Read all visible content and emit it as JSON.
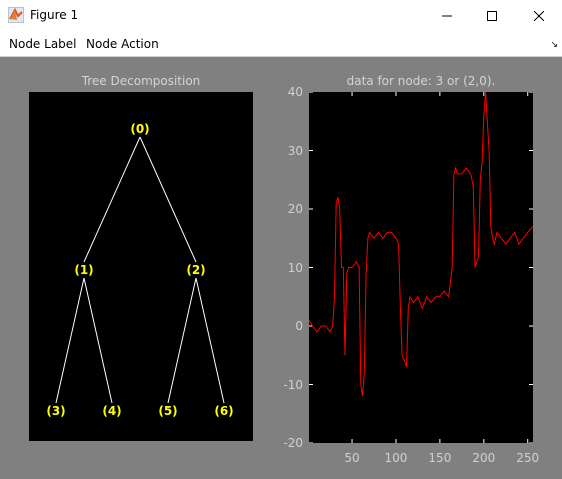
{
  "window": {
    "title": "Figure 1",
    "controls": [
      "minimize-icon",
      "maximize-icon",
      "close-icon"
    ]
  },
  "menu": {
    "items": [
      "Node Label",
      "Node Action"
    ],
    "overflow_icon": "corner-arrow-icon"
  },
  "tree_axes": {
    "title": "Tree Decomposition",
    "nodes": [
      {
        "label": "(0)",
        "parent": null
      },
      {
        "label": "(1)",
        "parent": 0
      },
      {
        "label": "(2)",
        "parent": 0
      },
      {
        "label": "(3)",
        "parent": 1
      },
      {
        "label": "(4)",
        "parent": 1
      },
      {
        "label": "(5)",
        "parent": 2
      },
      {
        "label": "(6)",
        "parent": 2
      }
    ],
    "colors": {
      "edge": "#ffffff",
      "label": "#ffff00",
      "background": "#000000"
    }
  },
  "chart_data": {
    "type": "line",
    "title": "data for node: 3 or (2,0).",
    "xlabel": "",
    "ylabel": "",
    "xlim": [
      1,
      256
    ],
    "ylim": [
      -20,
      40
    ],
    "xticks": [
      "50",
      "100",
      "150",
      "200",
      "250"
    ],
    "yticks": [
      "40",
      "30",
      "20",
      "10",
      "0",
      "-10",
      "-20"
    ],
    "grid": false,
    "series": [
      {
        "color": "#ff0000",
        "x": [
          1,
          5,
          10,
          15,
          20,
          25,
          28,
          30,
          32,
          34,
          36,
          38,
          40,
          42,
          44,
          46,
          50,
          55,
          58,
          60,
          62,
          64,
          66,
          68,
          70,
          75,
          80,
          85,
          90,
          95,
          100,
          103,
          105,
          107,
          110,
          112,
          114,
          116,
          120,
          125,
          130,
          135,
          140,
          145,
          150,
          155,
          160,
          164,
          166,
          168,
          170,
          175,
          180,
          185,
          188,
          190,
          192,
          194,
          196,
          198,
          200,
          202,
          204,
          206,
          208,
          210,
          212,
          215,
          220,
          225,
          230,
          235,
          240,
          245,
          250,
          256
        ],
        "y": [
          1,
          0,
          -1,
          0,
          0,
          -1,
          0,
          5,
          21,
          22,
          20,
          10,
          10,
          -5,
          9,
          10,
          10,
          11,
          10,
          -10,
          -12,
          -8,
          9,
          15,
          16,
          15,
          16,
          15,
          16,
          16,
          15,
          14,
          3,
          -5,
          -6,
          -7,
          3,
          5,
          4,
          5,
          3,
          5,
          4,
          5,
          5,
          6,
          5,
          10,
          26,
          27,
          26,
          26,
          27,
          26,
          24,
          10,
          11,
          12,
          25,
          28,
          36,
          40,
          35,
          30,
          17,
          15,
          14,
          16,
          15,
          14,
          15,
          16,
          14,
          15,
          16,
          17
        ]
      }
    ]
  }
}
